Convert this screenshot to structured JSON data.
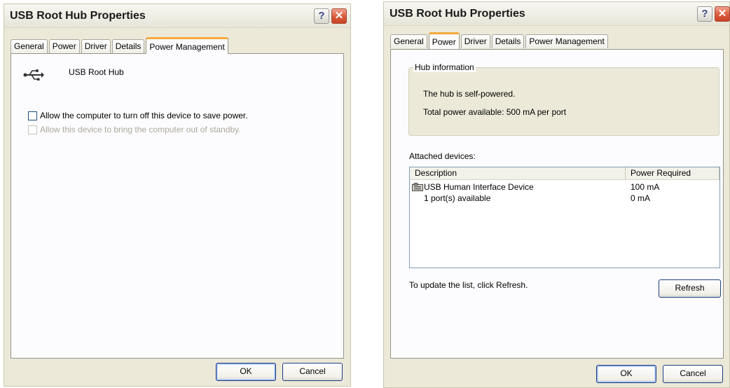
{
  "left_dialog": {
    "title": "USB Root Hub Properties",
    "help_glyph": "?",
    "close_glyph": "✕",
    "tabs": [
      "General",
      "Power",
      "Driver",
      "Details",
      "Power Management"
    ],
    "active_tab": "Power Management",
    "device_icon": "usb-trident-icon",
    "device_name": "USB Root Hub",
    "option_turn_off": {
      "label": "Allow the computer to turn off this device to save power.",
      "checked": false,
      "enabled": true
    },
    "option_wake": {
      "label": "Allow this device to bring the computer out of standby.",
      "checked": false,
      "enabled": false
    },
    "ok_label": "OK",
    "cancel_label": "Cancel"
  },
  "right_dialog": {
    "title": "USB Root Hub Properties",
    "help_glyph": "?",
    "close_glyph": "✕",
    "tabs": [
      "General",
      "Power",
      "Driver",
      "Details",
      "Power Management"
    ],
    "active_tab": "Power",
    "hub_info": {
      "legend": "Hub information",
      "self_powered": "The hub is self-powered.",
      "total_power": "Total power available:  500 mA per port"
    },
    "attached_label": "Attached devices:",
    "list": {
      "columns": [
        "Description",
        "Power Required"
      ],
      "rows": [
        {
          "description": "USB Human Interface Device",
          "power": "100 mA",
          "icon": "hid-device-icon"
        },
        {
          "description": "1 port(s) available",
          "power": "0 mA"
        }
      ]
    },
    "update_hint": "To update the list, click Refresh.",
    "refresh_label": "Refresh",
    "ok_label": "OK",
    "cancel_label": "Cancel"
  },
  "colors": {
    "dialog_bg": "#ece9d8",
    "active_tab_accent": "#f5a93a",
    "close_button": "#d95a3a",
    "disabled_text": "#aca899"
  }
}
